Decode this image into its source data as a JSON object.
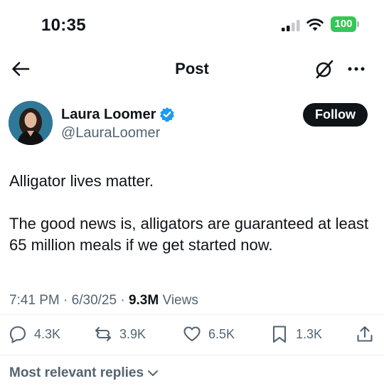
{
  "status_bar": {
    "time": "10:35",
    "battery": "100",
    "battery_color": "#34c759"
  },
  "nav": {
    "title": "Post"
  },
  "author": {
    "name": "Laura Loomer",
    "handle": "@LauraLoomer",
    "verified": true,
    "follow_label": "Follow"
  },
  "post": {
    "paragraphs": [
      "Alligator lives matter.",
      "The good news is, alligators are guaranteed at least 65 million meals if we get started now."
    ],
    "time": "7:41 PM",
    "date": "6/30/25",
    "views_count": "9.3M",
    "views_label": "Views"
  },
  "actions": {
    "replies": "4.3K",
    "reposts": "3.9K",
    "likes": "6.5K",
    "bookmarks": "1.3K"
  },
  "replies_sort": {
    "label": "Most relevant replies"
  },
  "colors": {
    "text": "#0f1419",
    "secondary": "#536471",
    "verified": "#1d9bf0"
  }
}
